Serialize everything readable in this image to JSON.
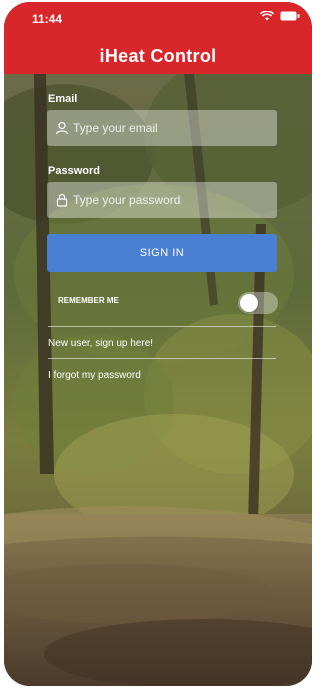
{
  "status_bar": {
    "time": "11:44",
    "icons": [
      "wifi-icon",
      "battery-icon"
    ]
  },
  "header": {
    "title": "iHeat Control",
    "color": "#d9262a"
  },
  "form": {
    "email": {
      "label": "Email",
      "placeholder": "Type your email",
      "value": "",
      "icon": "user-icon"
    },
    "password": {
      "label": "Password",
      "placeholder": "Type your password",
      "value": "",
      "icon": "lock-icon"
    },
    "sign_in_label": "SIGN IN",
    "sign_in_color": "#4a7fd4",
    "remember_me_label": "REMEMBER ME",
    "remember_me_on": false,
    "signup_link": "New user, sign up here!",
    "forgot_link": "I forgot my password"
  }
}
